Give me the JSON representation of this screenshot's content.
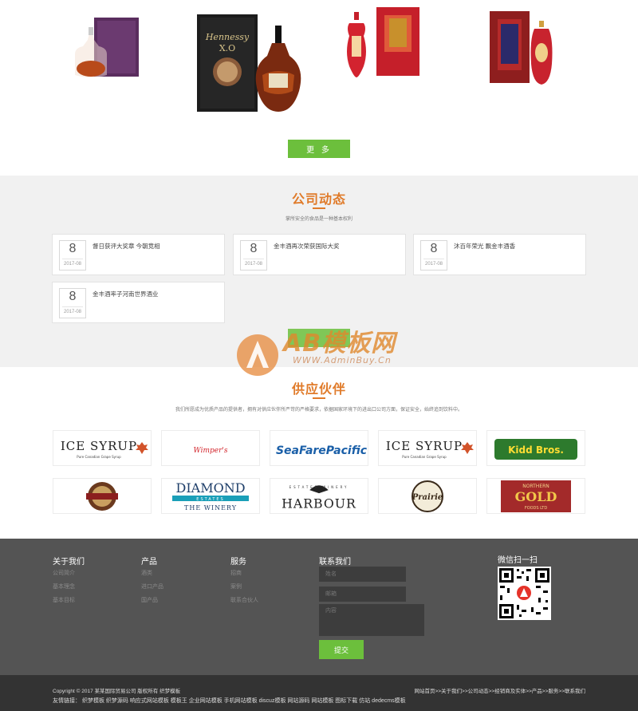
{
  "products": {
    "more_label": "更 多",
    "items": [
      {
        "name": "cognac-gift-box"
      },
      {
        "name": "hennessy-xo"
      },
      {
        "name": "red-baijiu-1"
      },
      {
        "name": "red-baijiu-2"
      }
    ],
    "hennessy_text": [
      "Hennessy",
      "X.O"
    ]
  },
  "news": {
    "title": "公司动态",
    "subtitle": "掌所安全的食品是一种基本权利",
    "items": [
      {
        "day": "8",
        "month": "2017-08",
        "title": "督日获评大奖章 今朝竞相"
      },
      {
        "day": "8",
        "month": "2017-08",
        "title": "金丰酒再次荣获国际大奖"
      },
      {
        "day": "8",
        "month": "2017-08",
        "title": "沐百年荣光 飘金丰酒香"
      },
      {
        "day": "8",
        "month": "2017-08",
        "title": "金丰酒率子河南世界酒业"
      }
    ]
  },
  "watermark": {
    "brand": "AB模板网",
    "url": "WWW.AdminBuy.Cn"
  },
  "partners": {
    "title": "供应伙伴",
    "subtitle": "我们所愿成为优质产品的提供者，拥有对供应伙伴所严苛的严格要求，依据国家环境下的进出口公司方面，保证安全，始终追到饮料中。",
    "logos": [
      {
        "name": "ice-syrup",
        "text": "ICE SYRUP",
        "sub": "Pure Canadian Grape Syrup"
      },
      {
        "name": "wimpers",
        "text": "Wimper's"
      },
      {
        "name": "seafare-pacific",
        "text": "SeaFarePacific"
      },
      {
        "name": "ice-syrup-2",
        "text": "ICE SYRUP",
        "sub": "Pure Canadian Grape Syrup"
      },
      {
        "name": "kidd-bros",
        "text": "Kidd Bros."
      },
      {
        "name": "seal-brand",
        "text": ""
      },
      {
        "name": "diamond-estates",
        "text": "DIAMOND",
        "sub": "ESTATES",
        "sub2": "THE WINERY"
      },
      {
        "name": "harbour",
        "text": "HARBOUR",
        "sub": "ESTATES WINERY"
      },
      {
        "name": "prairie",
        "text": "Prairie"
      },
      {
        "name": "northern-gold",
        "text": "NORTHERN",
        "sub": "GOLD",
        "sub2": "FOODS LTD"
      }
    ]
  },
  "footer": {
    "about": {
      "title": "关于我们",
      "links": [
        "公司简介",
        "基本理念",
        "基本目标"
      ]
    },
    "products": {
      "title": "产品",
      "links": [
        "酒类",
        "进口产品",
        "国产品"
      ]
    },
    "service": {
      "title": "服务",
      "links": [
        "招商",
        "案例",
        "联系合伙人"
      ]
    },
    "contact": {
      "title": "联系我们",
      "name_ph": "姓名",
      "email_ph": "邮箱",
      "msg_ph": "内容",
      "submit": "提交"
    },
    "wechat": {
      "title": "微信扫一扫"
    }
  },
  "bottom": {
    "copyright": "Copyright © 2017 某某国际贸易公司 版权所有  织梦模板",
    "crumbs": "网站首页>>关于我们>>公司动态>>经销商及实体>>产品>>服务>>联系我们",
    "friends": "友情链接：  织梦模板  织梦源码  响应式网站模板  模板王  企业网站模板  手机网站模板  discuz模板  网站源码  网站模板  图标下载  仿站  dedecms模板"
  },
  "colors": {
    "accent_green": "#6cbf3c",
    "title_orange": "#e07b2a",
    "footer_bg": "#545454",
    "bottom_bg": "#333333"
  }
}
